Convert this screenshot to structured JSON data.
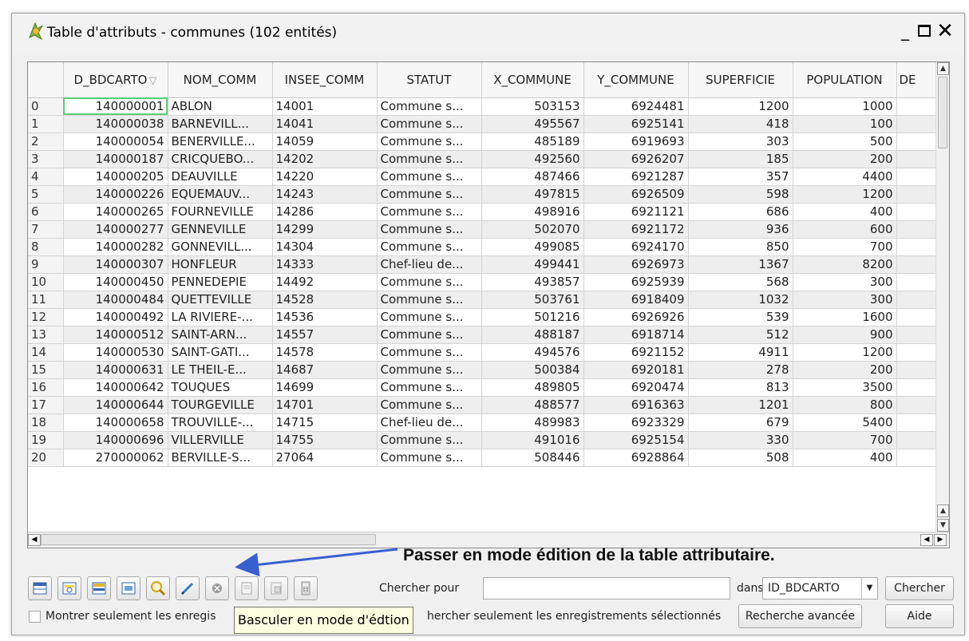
{
  "window": {
    "title": "Table d'attributs - communes (102 entités)",
    "minimize": "_",
    "close": "✕"
  },
  "table": {
    "columns": [
      "ID_BDCARTO",
      "NOM_COMM",
      "INSEE_COMM",
      "STATUT",
      "X_COMMUNE",
      "Y_COMMUNE",
      "SUPERFICIE",
      "POPULATION",
      "DE"
    ],
    "first_column_display": "D_BDCARTO",
    "rows": [
      [
        "0",
        "140000001",
        "ABLON",
        "14001",
        "Commune s...",
        "503153",
        "6924481",
        "1200",
        "1000"
      ],
      [
        "1",
        "140000038",
        "BARNEVILL...",
        "14041",
        "Commune s...",
        "495567",
        "6925141",
        "418",
        "100"
      ],
      [
        "2",
        "140000054",
        "BENERVILLE...",
        "14059",
        "Commune s...",
        "485189",
        "6919693",
        "303",
        "500"
      ],
      [
        "3",
        "140000187",
        "CRICQUEBO...",
        "14202",
        "Commune s...",
        "492560",
        "6926207",
        "185",
        "200"
      ],
      [
        "4",
        "140000205",
        "DEAUVILLE",
        "14220",
        "Commune s...",
        "487466",
        "6921287",
        "357",
        "4400"
      ],
      [
        "5",
        "140000226",
        "EQUEMAUV...",
        "14243",
        "Commune s...",
        "497815",
        "6926509",
        "598",
        "1200"
      ],
      [
        "6",
        "140000265",
        "FOURNEVILLE",
        "14286",
        "Commune s...",
        "498916",
        "6921121",
        "686",
        "400"
      ],
      [
        "7",
        "140000277",
        "GENNEVILLE",
        "14299",
        "Commune s...",
        "502070",
        "6921172",
        "936",
        "600"
      ],
      [
        "8",
        "140000282",
        "GONNEVILL...",
        "14304",
        "Commune s...",
        "499085",
        "6924170",
        "850",
        "700"
      ],
      [
        "9",
        "140000307",
        "HONFLEUR",
        "14333",
        "Chef-lieu de...",
        "499441",
        "6926973",
        "1367",
        "8200"
      ],
      [
        "10",
        "140000450",
        "PENNEDEPIE",
        "14492",
        "Commune s...",
        "493857",
        "6925939",
        "568",
        "300"
      ],
      [
        "11",
        "140000484",
        "QUETTEVILLE",
        "14528",
        "Commune s...",
        "503761",
        "6918409",
        "1032",
        "300"
      ],
      [
        "12",
        "140000492",
        "LA RIVIERE-...",
        "14536",
        "Commune s...",
        "501216",
        "6926926",
        "539",
        "1600"
      ],
      [
        "13",
        "140000512",
        "SAINT-ARN...",
        "14557",
        "Commune s...",
        "488187",
        "6918714",
        "512",
        "900"
      ],
      [
        "14",
        "140000530",
        "SAINT-GATI...",
        "14578",
        "Commune s...",
        "494576",
        "6921152",
        "4911",
        "1200"
      ],
      [
        "15",
        "140000631",
        "LE THEIL-E...",
        "14687",
        "Commune s...",
        "500384",
        "6920181",
        "278",
        "200"
      ],
      [
        "16",
        "140000642",
        "TOUQUES",
        "14699",
        "Commune s...",
        "489805",
        "6920474",
        "813",
        "3500"
      ],
      [
        "17",
        "140000644",
        "TOURGEVILLE",
        "14701",
        "Commune s...",
        "488577",
        "6916363",
        "1201",
        "800"
      ],
      [
        "18",
        "140000658",
        "TROUVILLE-...",
        "14715",
        "Chef-lieu de...",
        "489983",
        "6923329",
        "679",
        "5400"
      ],
      [
        "19",
        "140000696",
        "VILLERVILLE",
        "14755",
        "Commune s...",
        "491016",
        "6925154",
        "330",
        "700"
      ],
      [
        "20",
        "270000062",
        "BERVILLE-S...",
        "27064",
        "Commune s...",
        "508446",
        "6928864",
        "508",
        "400"
      ]
    ]
  },
  "annotation": "Passer en mode édition de la table attributaire.",
  "toolbar": {
    "icons": [
      "table-icon",
      "zoom-selection-icon",
      "move-selection-top-icon",
      "invert-selection-icon",
      "search-icon",
      "edit-pencil-icon",
      "delete-icon",
      "copy-icon",
      "paste-icon",
      "calculator-icon"
    ],
    "search_label": "Chercher pour",
    "search_value": "",
    "in_label": "dans",
    "field_select": "ID_BDCARTO",
    "search_button": "Chercher"
  },
  "footer": {
    "show_selected_label": "Montrer seulement les enregis",
    "search_selected_label": "hercher seulement les enregistrements sélectionnés",
    "advanced_button": "Recherche avancée",
    "help_button": "Aide"
  },
  "tooltip": "Basculer en mode d'édtion",
  "colors": {
    "current_cell_outline": "#5fcd7a",
    "annotation_arrow": "#3a5fd0",
    "tooltip_bg": "#ffffe1"
  }
}
